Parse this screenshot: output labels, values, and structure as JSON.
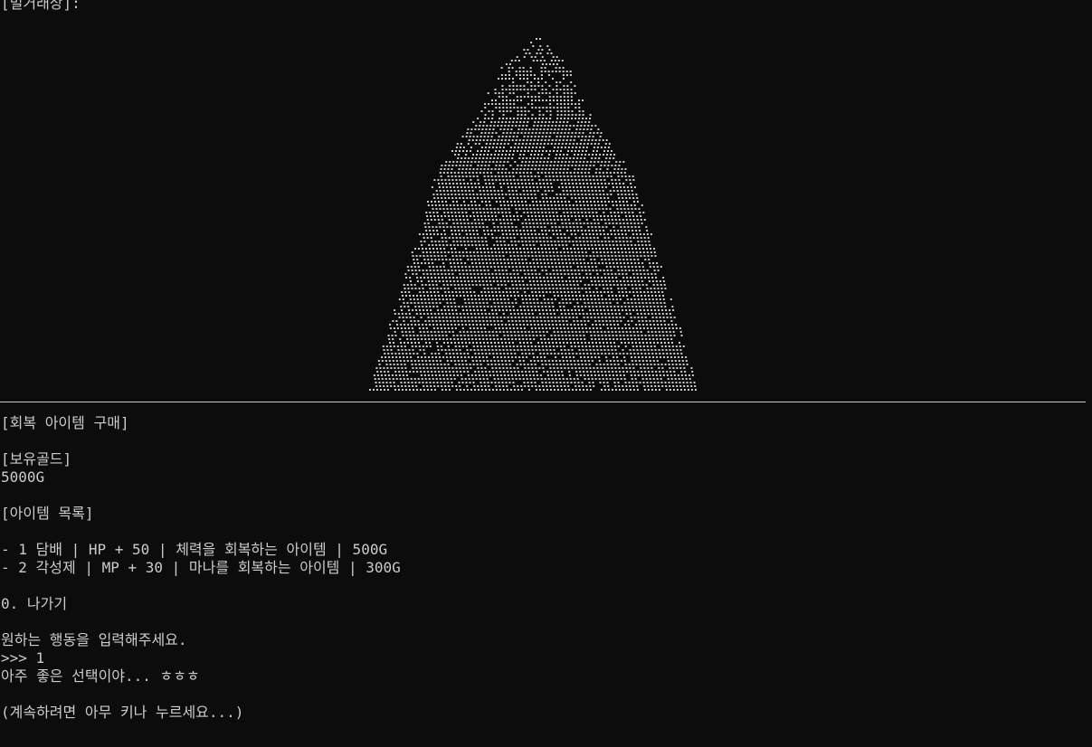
{
  "header_label": "[밀거래상]:",
  "portrait": {
    "icon": "hooded-merchant-ascii-art",
    "color": "#cccccc"
  },
  "shop": {
    "title": "[회복 아이템 구매]",
    "gold_label": "[보유골드]",
    "gold_value": "5000G",
    "items_title": "[아이템 목록]",
    "items": [
      "- 1 담배 | HP + 50 | 체력을 회복하는 아이템 | 500G",
      "- 2 각성제 | MP + 30 | 마나를 회복하는 아이템 | 300G"
    ],
    "exit_option": "0. 나가기"
  },
  "prompt": {
    "instruction": "원하는 행동을 입력해주세요.",
    "input_line": ">>> 1",
    "response": "아주 좋은 선택이야... ㅎㅎㅎ",
    "continue": "(계속하려면 아무 키나 누르세요...)"
  },
  "colors": {
    "background": "#0c0c0c",
    "text": "#cccccc"
  }
}
